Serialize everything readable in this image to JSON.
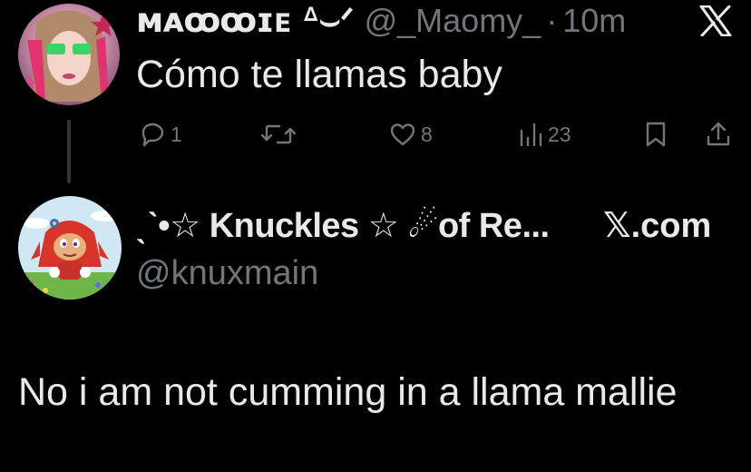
{
  "tweet": {
    "display_name": "ᴍᴀꝏꝏɪᴇ ᐞ⌣ᐟ",
    "handle": "@_Maomy_",
    "separator": "·",
    "time": "10m",
    "text": "Cómo te llamas baby",
    "actions": {
      "reply_count": "1",
      "retweet_count": "",
      "like_count": "8",
      "views_count": "23"
    }
  },
  "reply": {
    "display_name": "ˎˋ•☆ Knuckles ☆ ☄︎of Re...",
    "site": "𝕏.com",
    "handle": "@knuxmain",
    "text": "No i am not cumming in a llama mallie"
  },
  "colors": {
    "background": "#000000",
    "primary_text": "#e7e9ea",
    "secondary_text": "#71767b",
    "thread_line": "#333639"
  }
}
